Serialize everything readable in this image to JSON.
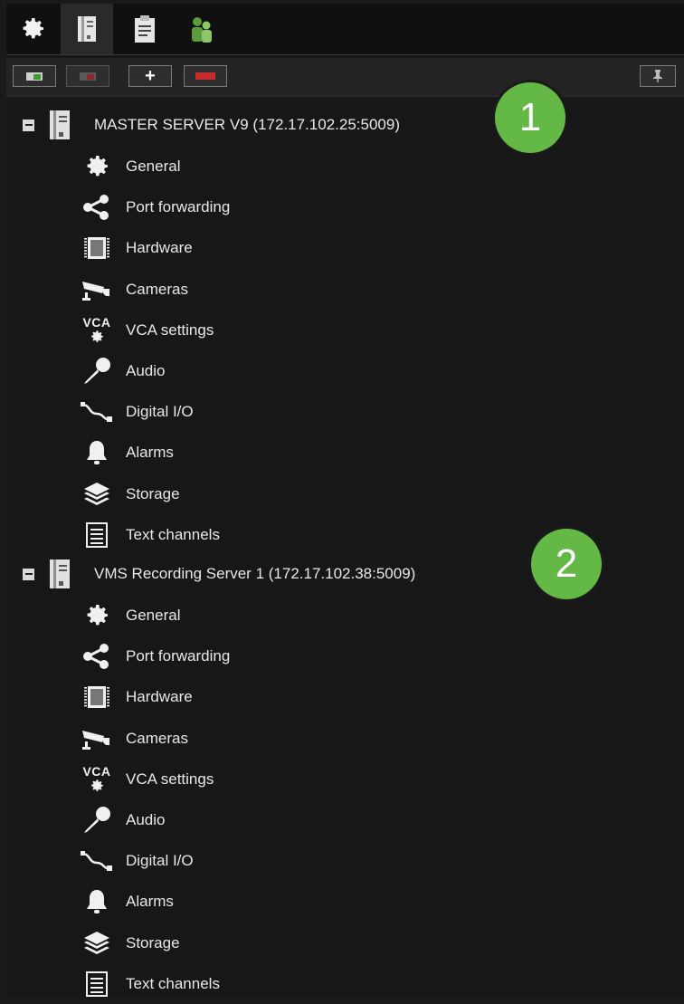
{
  "tabs": [
    {
      "name": "settings-tab",
      "icon": "gear-icon"
    },
    {
      "name": "servers-tab",
      "icon": "server-icon"
    },
    {
      "name": "clipboard-tab",
      "icon": "clipboard-icon"
    },
    {
      "name": "users-tab",
      "icon": "users-icon"
    }
  ],
  "toolbar": {
    "add_server": {
      "icon": "add-server-icon"
    },
    "remove_server": {
      "icon": "remove-server-icon"
    },
    "plus_label": "+",
    "minus_label": "−",
    "extra": {
      "icon": "pin-icon"
    }
  },
  "servers": [
    {
      "label": "MASTER SERVER V9 (172.17.102.25:5009)",
      "badge": "1",
      "children": [
        {
          "label": "General",
          "icon": "gear-icon"
        },
        {
          "label": "Port forwarding",
          "icon": "share-icon"
        },
        {
          "label": "Hardware",
          "icon": "chip-icon"
        },
        {
          "label": "Cameras",
          "icon": "camera-icon"
        },
        {
          "label": "VCA settings",
          "icon": "vca-icon",
          "icon_text": "VCA"
        },
        {
          "label": "Audio",
          "icon": "microphone-icon"
        },
        {
          "label": "Digital I/O",
          "icon": "digital-io-icon"
        },
        {
          "label": "Alarms",
          "icon": "bell-icon"
        },
        {
          "label": "Storage",
          "icon": "layers-icon"
        },
        {
          "label": "Text channels",
          "icon": "text-list-icon"
        }
      ]
    },
    {
      "label": "VMS Recording Server 1 (172.17.102.38:5009)",
      "badge": "2",
      "children": [
        {
          "label": "General",
          "icon": "gear-icon"
        },
        {
          "label": "Port forwarding",
          "icon": "share-icon"
        },
        {
          "label": "Hardware",
          "icon": "chip-icon"
        },
        {
          "label": "Cameras",
          "icon": "camera-icon"
        },
        {
          "label": "VCA settings",
          "icon": "vca-icon",
          "icon_text": "VCA"
        },
        {
          "label": "Audio",
          "icon": "microphone-icon"
        },
        {
          "label": "Digital I/O",
          "icon": "digital-io-icon"
        },
        {
          "label": "Alarms",
          "icon": "bell-icon"
        },
        {
          "label": "Storage",
          "icon": "layers-icon"
        },
        {
          "label": "Text channels",
          "icon": "text-list-icon"
        }
      ]
    }
  ],
  "colors": {
    "badge": "#64b946",
    "background": "#171717",
    "text": "#e8e8e8"
  }
}
